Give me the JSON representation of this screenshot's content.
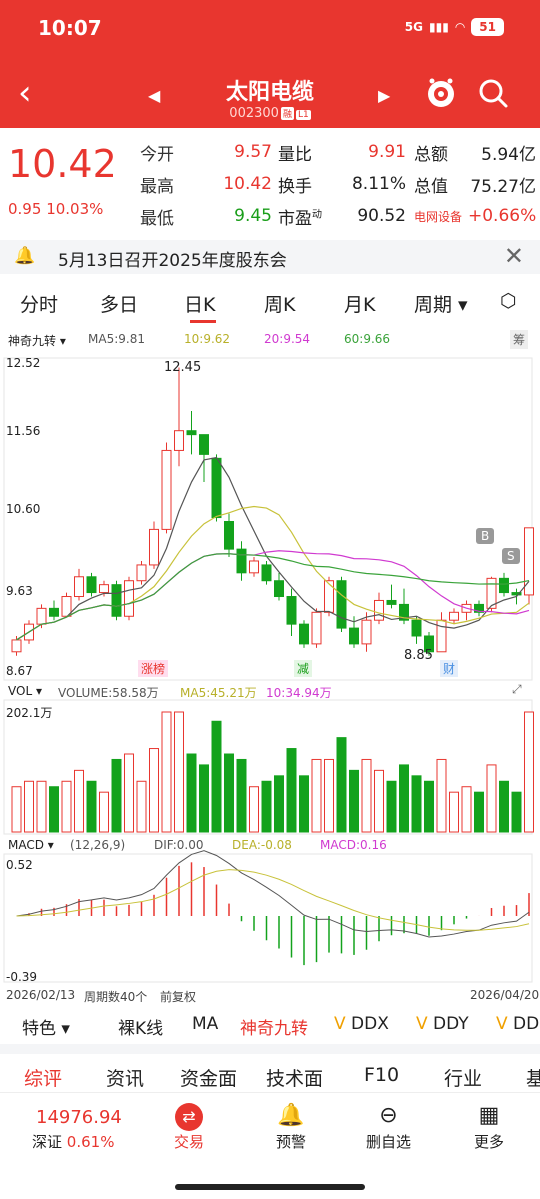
{
  "status": {
    "time": "10:07",
    "network": "5G",
    "battery": "51"
  },
  "header": {
    "title": "太阳电缆",
    "code": "002300",
    "tag1": "融",
    "tag2": "L1"
  },
  "quote": {
    "price": "10.42",
    "change": "0.95",
    "change_pct": "10.03%",
    "rows": [
      {
        "l1": "今开",
        "v1": "9.57",
        "l2": "量比",
        "v2": "9.91",
        "l3": "总额",
        "v3": "5.94亿"
      },
      {
        "l1": "最高",
        "v1": "10.42",
        "l2": "换手",
        "v2": "8.11%",
        "l3": "总值",
        "v3": "75.27亿"
      },
      {
        "l1": "最低",
        "v1": "9.45",
        "l2": "市盈",
        "sup": "动",
        "v2": "90.52",
        "l3": "电网设备",
        "v3": "+0.66%"
      }
    ]
  },
  "notice": {
    "text": "5月13日召开2025年度股东会"
  },
  "tabs": [
    "分时",
    "多日",
    "日K",
    "周K",
    "月K",
    "周期"
  ],
  "active_tab": "日K",
  "kline": {
    "indicator": "神奇九转",
    "ma5": "MA5:9.81",
    "ma10": "10:9.62",
    "ma20": "20:9.54",
    "ma60": "60:9.66",
    "chip_btn": "筹",
    "axis": [
      "12.52",
      "11.56",
      "10.60",
      "9.63",
      "8.67"
    ],
    "high_label": "12.45",
    "low_label": "8.85",
    "markers": {
      "zb": "涨榜",
      "jian": "减",
      "cai": "财",
      "b": "B",
      "s": "S"
    },
    "colors": {
      "up": "#e8362f",
      "down": "#13a21c",
      "ma5": "#555555",
      "ma10": "#c8c23a",
      "ma20": "#d03ad0",
      "ma60": "#3aa33a"
    }
  },
  "chart_data": {
    "type": "bar",
    "title": "",
    "candles": [
      [
        8.85,
        9.0,
        8.8,
        9.05
      ],
      [
        9.0,
        9.2,
        8.95,
        9.25
      ],
      [
        9.2,
        9.4,
        9.15,
        9.45
      ],
      [
        9.4,
        9.3,
        9.25,
        9.5
      ],
      [
        9.3,
        9.55,
        9.3,
        9.6
      ],
      [
        9.55,
        9.8,
        9.5,
        9.9
      ],
      [
        9.8,
        9.6,
        9.55,
        9.85
      ],
      [
        9.6,
        9.7,
        9.55,
        9.75
      ],
      [
        9.7,
        9.3,
        9.25,
        9.75
      ],
      [
        9.3,
        9.75,
        9.25,
        9.8
      ],
      [
        9.75,
        9.95,
        9.7,
        10.0
      ],
      [
        9.95,
        10.4,
        9.9,
        10.5
      ],
      [
        10.4,
        11.4,
        10.35,
        11.5
      ],
      [
        11.4,
        11.65,
        11.2,
        12.45
      ],
      [
        11.65,
        11.6,
        11.35,
        11.9
      ],
      [
        11.6,
        11.35,
        11.0,
        11.45
      ],
      [
        11.3,
        10.55,
        10.5,
        11.35
      ],
      [
        10.5,
        10.15,
        10.05,
        10.6
      ],
      [
        10.15,
        9.85,
        9.75,
        10.25
      ],
      [
        9.85,
        10.0,
        9.8,
        10.05
      ],
      [
        9.95,
        9.75,
        9.7,
        10.0
      ],
      [
        9.75,
        9.55,
        9.5,
        9.85
      ],
      [
        9.55,
        9.2,
        9.05,
        9.65
      ],
      [
        9.2,
        8.95,
        8.9,
        9.25
      ],
      [
        8.95,
        9.35,
        8.9,
        9.4
      ],
      [
        9.35,
        9.75,
        9.3,
        9.8
      ],
      [
        9.75,
        9.15,
        9.1,
        9.8
      ],
      [
        9.15,
        8.95,
        8.9,
        9.3
      ],
      [
        8.95,
        9.25,
        8.85,
        9.35
      ],
      [
        9.25,
        9.5,
        9.2,
        9.6
      ],
      [
        9.5,
        9.45,
        9.4,
        9.7
      ],
      [
        9.45,
        9.25,
        9.2,
        9.65
      ],
      [
        9.25,
        9.05,
        8.95,
        9.3
      ],
      [
        9.05,
        8.85,
        8.8,
        9.1
      ],
      [
        8.85,
        9.25,
        8.85,
        9.35
      ],
      [
        9.25,
        9.35,
        9.2,
        9.4
      ],
      [
        9.35,
        9.45,
        9.25,
        9.5
      ],
      [
        9.45,
        9.35,
        9.3,
        9.5
      ],
      [
        9.4,
        9.78,
        9.35,
        9.8
      ],
      [
        9.78,
        9.6,
        9.55,
        9.85
      ],
      [
        9.6,
        9.57,
        9.45,
        9.65
      ],
      [
        9.57,
        10.42,
        9.45,
        10.42
      ]
    ],
    "volume": {
      "labels": [
        "VOL",
        "VOLUME:58.58万",
        "MA5:45.21万",
        "10:34.94万"
      ],
      "max_label": "202.1万"
    },
    "macd": {
      "labels": [
        "MACD",
        "(12,26,9)",
        "DIF:0.00",
        "DEA:-0.08",
        "MACD:0.16"
      ],
      "top": "0.52",
      "bottom": "-0.39"
    },
    "x_start": "2026/02/13",
    "x_end": "2026/04/20",
    "period_note": "周期数40个",
    "adjust": "前复权"
  },
  "strip": [
    "特色",
    "裸K线",
    "MA",
    "神奇九转",
    "DDX",
    "DDY",
    "DD"
  ],
  "sections": [
    "综评",
    "资讯",
    "资金面",
    "技术面",
    "F10",
    "行业",
    "基"
  ],
  "footer": {
    "index_value": "14976.94",
    "index_name": "深证",
    "index_pct": "0.61%",
    "trade": "交易",
    "alert": "预警",
    "remove": "删自选",
    "more": "更多"
  }
}
